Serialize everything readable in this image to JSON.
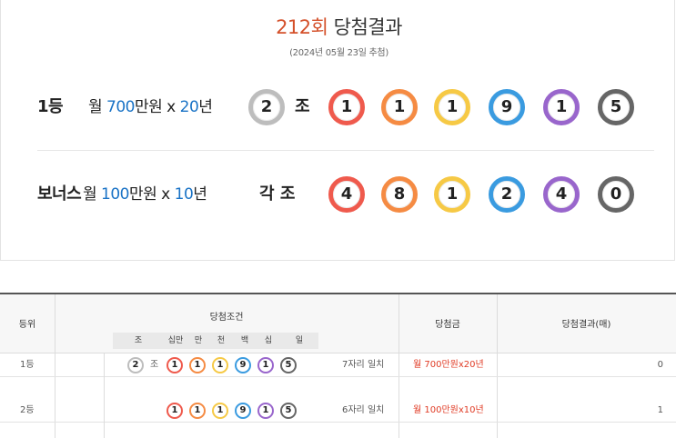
{
  "header": {
    "round": "212회",
    "title_rest": " 당첨결과",
    "date": "(2024년 05월 23일 추첨)"
  },
  "first": {
    "rank": "1등",
    "prize_pre": "월 ",
    "prize_amount": "700",
    "prize_mid": "만원 x ",
    "prize_years": "20",
    "prize_post": "년",
    "jo_ball": "2",
    "jo_label": "조",
    "balls": [
      "1",
      "1",
      "1",
      "9",
      "1",
      "5"
    ]
  },
  "bonus": {
    "rank": "보너스",
    "prize_pre": " 월 ",
    "prize_amount": "100",
    "prize_mid": "만원 x ",
    "prize_years": "10",
    "prize_post": "년",
    "jo_label": "각 조",
    "balls": [
      "4",
      "8",
      "1",
      "2",
      "4",
      "0"
    ]
  },
  "colors": {
    "gray": "#b4b4b4",
    "red": "#ef5a4d",
    "orange": "#f58b43",
    "yellow": "#f6c945",
    "blue": "#3a9be0",
    "purple": "#9966cc",
    "dark": "#666666"
  },
  "table": {
    "headers": {
      "rank": "등위",
      "condition": "당첨조건",
      "prize": "당첨금",
      "result": "당첨결과(매)"
    },
    "subheaders": [
      "조",
      "십만",
      "만",
      "천",
      "백",
      "십",
      "일"
    ],
    "rows": [
      {
        "rank": "1등",
        "jo_ball": "2",
        "jo_label": "조",
        "balls": [
          "1",
          "1",
          "1",
          "9",
          "1",
          "5"
        ],
        "match": "7자리 일치",
        "prize": "월 700만원x20년",
        "count": "0"
      },
      {
        "rank": "2등",
        "balls": [
          "1",
          "1",
          "1",
          "9",
          "1",
          "5"
        ],
        "match": "6자리 일치",
        "prize": "월 100만원x10년",
        "count": "1"
      }
    ]
  }
}
